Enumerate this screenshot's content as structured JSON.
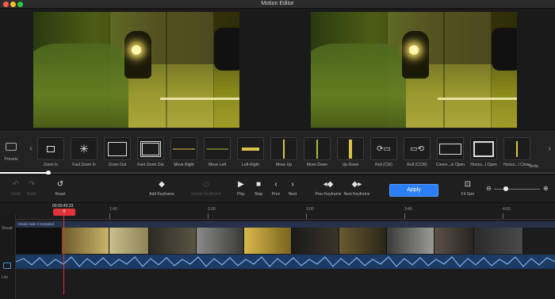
{
  "window": {
    "title": "Motion Editor"
  },
  "presets": {
    "label": "Presets",
    "items": [
      {
        "label": "Zoom In",
        "icon": "zoom-in-icon"
      },
      {
        "label": "Fast Zoom In",
        "icon": "fast-zoom-in-icon"
      },
      {
        "label": "Zoom Out",
        "icon": "zoom-out-icon"
      },
      {
        "label": "Fast Zoom Out",
        "icon": "fast-zoom-out-icon"
      },
      {
        "label": "Move Right",
        "icon": "move-right-icon"
      },
      {
        "label": "Move Left",
        "icon": "move-left-icon"
      },
      {
        "label": "Left-Right",
        "icon": "left-right-icon"
      },
      {
        "label": "Move Up",
        "icon": "move-up-icon"
      },
      {
        "label": "Move Down",
        "icon": "move-down-icon"
      },
      {
        "label": "Up-Down",
        "icon": "up-down-icon"
      },
      {
        "label": "Roll (CW)",
        "icon": "roll-cw-icon"
      },
      {
        "label": "Roll (CCW)",
        "icon": "roll-ccw-icon"
      },
      {
        "label": "Cinem...io Open",
        "icon": "cinema-open-icon"
      },
      {
        "label": "Horizo...l Open",
        "icon": "horizontal-open-icon"
      },
      {
        "label": "Horizo...l Close",
        "icon": "horizontal-close-icon"
      },
      {
        "label": "Vertic",
        "icon": "vertical-icon"
      }
    ]
  },
  "toolbar": {
    "undo": "Undo",
    "redo": "Redo",
    "reset": "Reset",
    "add_keyframe": "Add Keyframe",
    "delete_keyframe": "Delete Keyframe",
    "play": "Play",
    "stop": "Stop",
    "prev": "Prev",
    "next": "Next",
    "prev_keyframe": "Prev Keyframe",
    "next_keyframe": "Next Keyframe",
    "apply": "Apply",
    "fit_size": "Fit Size"
  },
  "timeline": {
    "playhead_time": "00:00:49.23",
    "playhead_flag": "0",
    "ticks": [
      "1:40",
      "2:00",
      "3:00",
      "3:40",
      "4:00"
    ],
    "track_labels": {
      "visual": "Visual",
      "list": "List"
    },
    "clip_name": "Kinda Hate It Sampled"
  }
}
